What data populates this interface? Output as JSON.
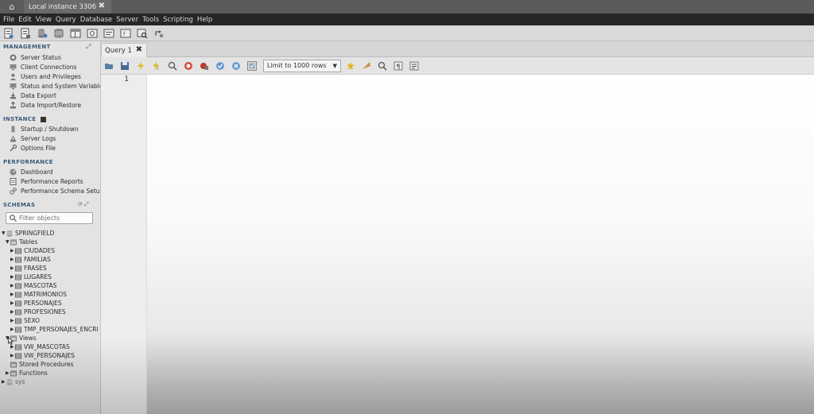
{
  "window": {
    "instance_tab": "Local instance 3306",
    "close_glyph": "✖",
    "home_glyph": "⌂"
  },
  "menu": [
    "File",
    "Edit",
    "View",
    "Query",
    "Database",
    "Server",
    "Tools",
    "Scripting",
    "Help"
  ],
  "sidebar": {
    "management": {
      "title": "MANAGEMENT",
      "items": [
        "Server Status",
        "Client Connections",
        "Users and Privileges",
        "Status and System Variables",
        "Data Export",
        "Data Import/Restore"
      ]
    },
    "instance": {
      "title": "INSTANCE",
      "items": [
        "Startup / Shutdown",
        "Server Logs",
        "Options File"
      ]
    },
    "performance": {
      "title": "PERFORMANCE",
      "items": [
        "Dashboard",
        "Performance Reports",
        "Performance Schema Setup"
      ]
    },
    "schemas": {
      "title": "SCHEMAS",
      "filter_placeholder": "Filter objects",
      "schema_name": "SPRINGFIELD",
      "tables_label": "Tables",
      "tables": [
        "CIUDADES",
        "FAMILIAS",
        "FRASES",
        "LUGARES",
        "MASCOTAS",
        "MATRIMONIOS",
        "PERSONAJES",
        "PROFESIONES",
        "SEXO",
        "TMP_PERSONAJES_ENCRI"
      ],
      "views_label": "Views",
      "views": [
        "VW_MASCOTAS",
        "VW_PERSONAJES"
      ],
      "stored_procedures_label": "Stored Procedures",
      "functions_label": "Functions",
      "other_schema": "sys"
    }
  },
  "query": {
    "tab_label": "Query 1",
    "limit_label": "Limit to 1000 rows",
    "line_number": "1"
  },
  "colors": {
    "accent": "#3a5a7a",
    "menubar": "#262626",
    "tabbar": "#5b5b5b"
  }
}
